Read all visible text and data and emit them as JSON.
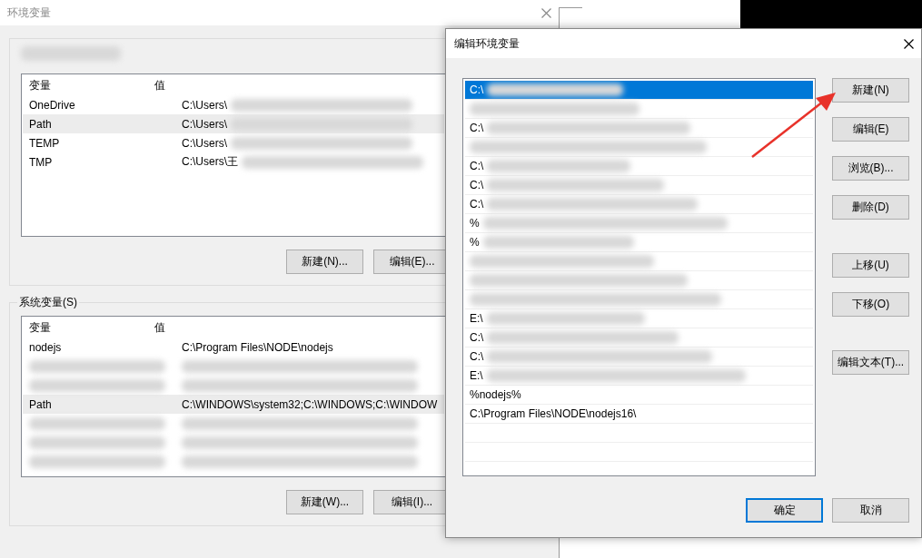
{
  "env_window": {
    "title": "环境变量",
    "user_vars": {
      "columns": [
        "变量",
        "值"
      ],
      "rows": [
        {
          "name": "OneDrive",
          "value": "C:\\Users\\",
          "selected": false,
          "blurred": true
        },
        {
          "name": "Path",
          "value": "C:\\Users\\",
          "selected": true,
          "blurred": true
        },
        {
          "name": "TEMP",
          "value": "C:\\Users\\",
          "selected": false,
          "blurred": true
        },
        {
          "name": "TMP",
          "value": "C:\\Users\\王",
          "selected": false,
          "blurred": true
        }
      ],
      "buttons": [
        "新建(N)...",
        "编辑(E)..."
      ]
    },
    "system_vars": {
      "label": "系统变量(S)",
      "columns": [
        "变量",
        "值"
      ],
      "rows": [
        {
          "name": "nodejs",
          "value": "C:\\Program Files\\NODE\\nodejs",
          "selected": false,
          "blurred": false
        },
        {
          "selected": false,
          "blurred": true
        },
        {
          "selected": false,
          "blurred": true
        },
        {
          "name": "Path",
          "value": "C:\\WINDOWS\\system32;C:\\WINDOWS;C:\\WINDOW",
          "selected": true,
          "blurred": false
        },
        {
          "selected": false,
          "blurred": true
        },
        {
          "selected": false,
          "blurred": true
        },
        {
          "selected": false,
          "blurred": true
        }
      ],
      "buttons": [
        "新建(W)...",
        "编辑(I)..."
      ]
    }
  },
  "edit_dialog": {
    "title": "编辑环境变量",
    "entries": [
      {
        "value": "C:\\",
        "selected": true,
        "blurred": true
      },
      {
        "selected": false,
        "blurred": true
      },
      {
        "value": "C:\\",
        "selected": false,
        "blurred": true
      },
      {
        "selected": false,
        "blurred": true
      },
      {
        "value": "C:\\",
        "selected": false,
        "blurred": true
      },
      {
        "value": "C:\\",
        "selected": false,
        "blurred": true
      },
      {
        "value": "C:\\",
        "selected": false,
        "blurred": true
      },
      {
        "value": "%",
        "selected": false,
        "blurred": true
      },
      {
        "value": "%",
        "selected": false,
        "blurred": true
      },
      {
        "selected": false,
        "blurred": true
      },
      {
        "selected": false,
        "blurred": true
      },
      {
        "selected": false,
        "blurred": true
      },
      {
        "value": "E:\\",
        "selected": false,
        "blurred": true
      },
      {
        "value": "C:\\",
        "selected": false,
        "blurred": true
      },
      {
        "value": "C:\\",
        "selected": false,
        "blurred": true
      },
      {
        "value": "E:\\",
        "selected": false,
        "blurred": true
      },
      {
        "value": "%nodejs%",
        "selected": false,
        "blurred": false
      },
      {
        "value": "C:\\Program Files\\NODE\\nodejs16\\",
        "selected": false,
        "blurred": false
      }
    ],
    "side_button_groups": [
      [
        "新建(N)",
        "编辑(E)",
        "浏览(B)...",
        "删除(D)"
      ],
      [
        "上移(U)",
        "下移(O)"
      ],
      [
        "编辑文本(T)..."
      ]
    ],
    "footer_buttons": [
      {
        "label": "确定",
        "default": true
      },
      {
        "label": "取消",
        "default": false
      }
    ]
  }
}
